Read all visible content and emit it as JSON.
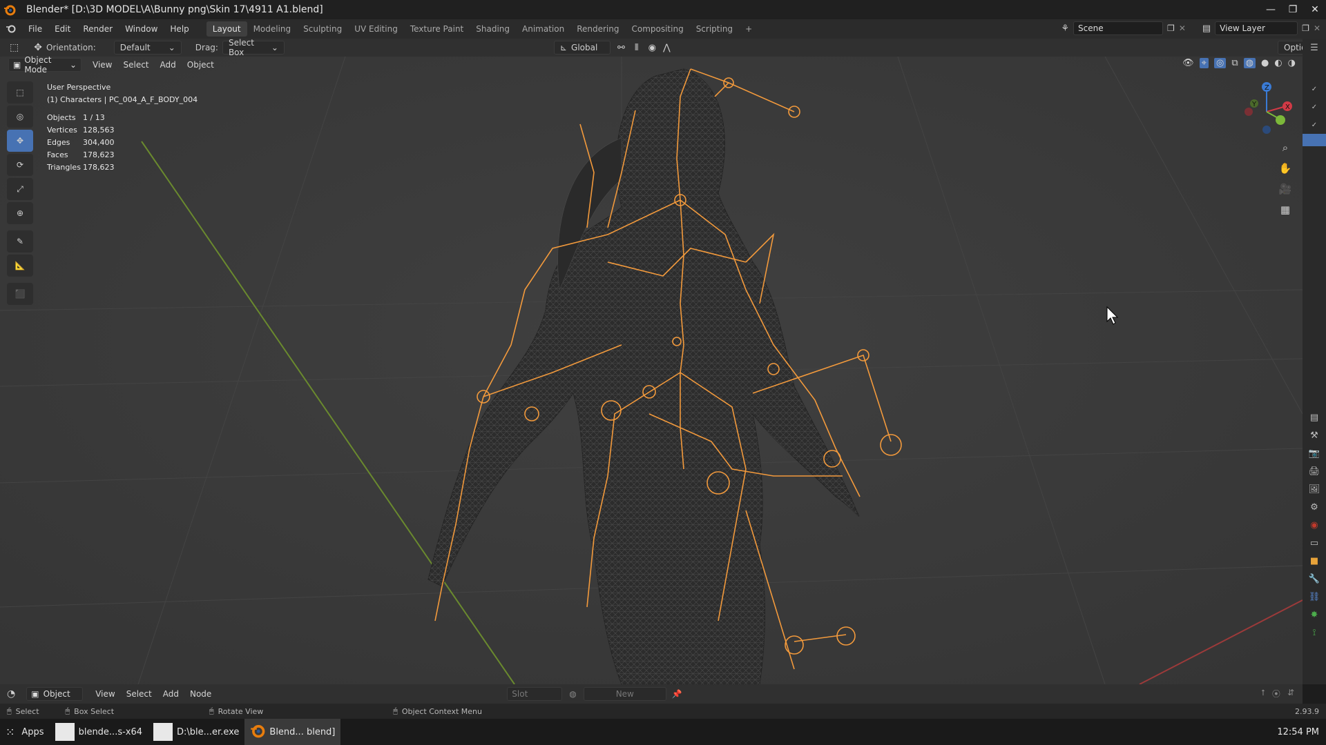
{
  "titlebar": {
    "title": "Blender* [D:\\3D MODEL\\A\\Bunny png\\Skin 17\\4911 A1.blend]",
    "minimize": "—",
    "maximize": "❐",
    "close": "✕"
  },
  "menubar": {
    "menus": [
      "File",
      "Edit",
      "Render",
      "Window",
      "Help"
    ],
    "workspaces": [
      "Layout",
      "Modeling",
      "Sculpting",
      "UV Editing",
      "Texture Paint",
      "Shading",
      "Animation",
      "Rendering",
      "Compositing",
      "Scripting"
    ],
    "active_workspace": "Layout",
    "add_tab": "+",
    "scene": "Scene",
    "view_layer": "View Layer"
  },
  "toolheader": {
    "orientation_label": "Orientation:",
    "orientation_value": "Default",
    "drag_label": "Drag:",
    "drag_value": "Select Box",
    "transform_space": "Global",
    "options": "Options"
  },
  "viewport_header": {
    "mode": "Object Mode",
    "menus": [
      "View",
      "Select",
      "Add",
      "Object"
    ]
  },
  "overlay": {
    "view_name": "User Perspective",
    "active_object": "(1) Characters | PC_004_A_F_BODY_004"
  },
  "stats": [
    {
      "label": "Objects",
      "value": "1 / 13"
    },
    {
      "label": "Vertices",
      "value": "128,563"
    },
    {
      "label": "Edges",
      "value": "304,400"
    },
    {
      "label": "Faces",
      "value": "178,623"
    },
    {
      "label": "Triangles",
      "value": "178,623"
    }
  ],
  "gizmo": {
    "x": "X",
    "y": "Y",
    "z": "Z"
  },
  "node_header": {
    "mode": "Object",
    "menus": [
      "View",
      "Select",
      "Add",
      "Node"
    ],
    "slot": "Slot",
    "new_button": "New"
  },
  "statusbar": {
    "items": [
      "Select",
      "Box Select",
      "Rotate View",
      "Object Context Menu"
    ],
    "version": "2.93.9"
  },
  "taskbar": {
    "apps_label": "Apps",
    "tasks": [
      "blende...s-x64",
      "D:\\ble...er.exe",
      "Blend... blend]"
    ],
    "clock": "12:54 PM"
  },
  "colors": {
    "accent": "#4772b3",
    "armature": "#f39a3c",
    "grid_y_axis": "#6a8a2e",
    "grid_x_axis": "#9c3a3a"
  }
}
